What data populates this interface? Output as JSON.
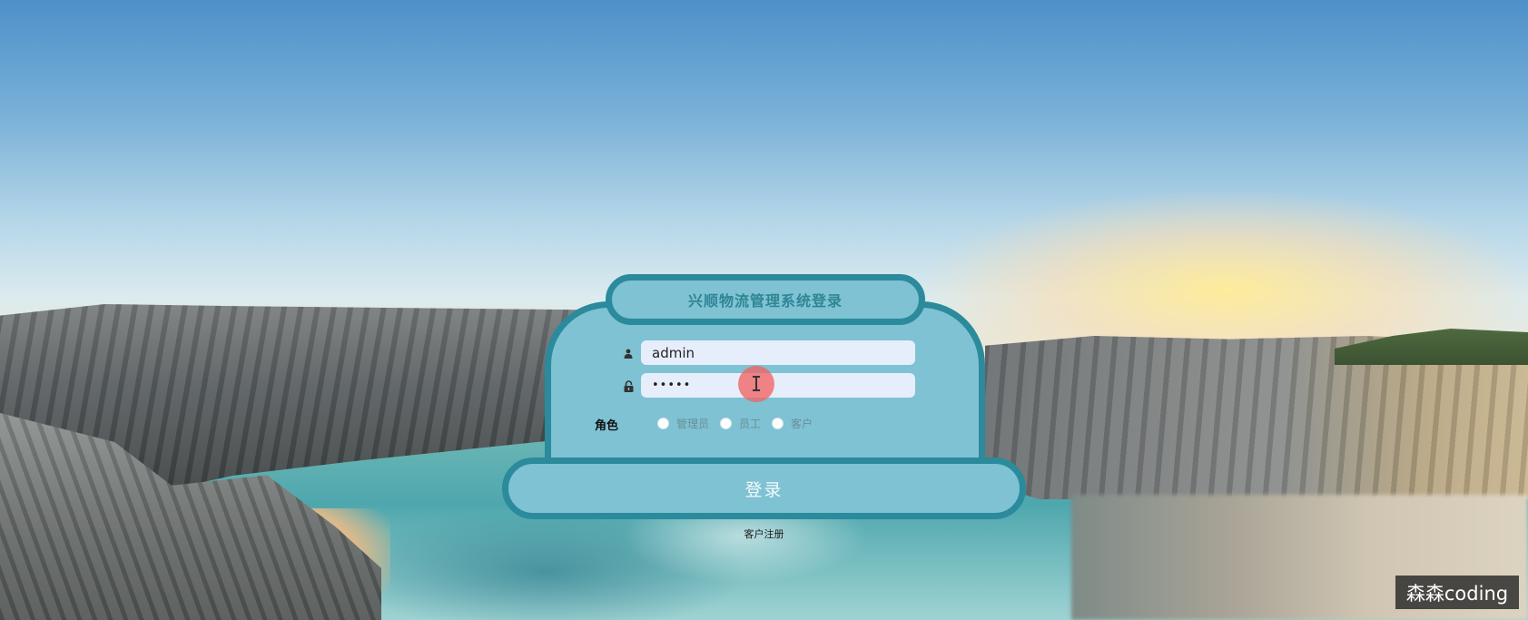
{
  "login": {
    "title": "兴顺物流管理系统登录",
    "username_value": "admin",
    "password_value": "•••••",
    "role_label": "角色",
    "roles": [
      "管理员",
      "员工",
      "客户"
    ],
    "submit_label": "登录",
    "register_link": "客户注册"
  },
  "icons": {
    "username": "user-icon",
    "password": "lock-icon"
  },
  "watermark": "森森coding",
  "colors": {
    "card_fill": "#7ec2d3",
    "card_border": "#2b8a9c",
    "title_text": "#2f8595",
    "input_bg": "#e7eefb"
  }
}
